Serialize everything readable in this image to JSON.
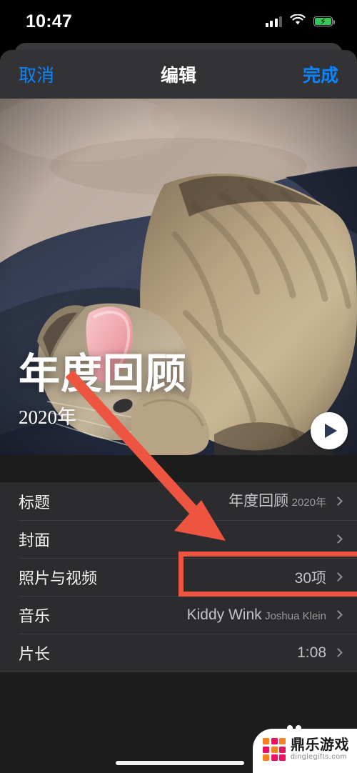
{
  "status_bar": {
    "time": "10:47",
    "signal_icon": "cellular-signal-icon",
    "wifi_icon": "wifi-icon",
    "battery_icon": "battery-charging-icon",
    "battery_bolt": "⚡"
  },
  "nav_bar": {
    "cancel_label": "取消",
    "title": "编辑",
    "done_label": "完成",
    "accent_color": "#0A84FF"
  },
  "hero": {
    "title": "年度回顾",
    "subtitle": "2020年",
    "play_icon": "play-icon",
    "image_description": "tabby cat with pink collar resting on dark navy clothing"
  },
  "table": {
    "rows": [
      {
        "label": "标题",
        "value": "年度回顾",
        "sub": "2020年",
        "name": "row-title"
      },
      {
        "label": "封面",
        "value": "",
        "sub": "",
        "name": "row-cover"
      },
      {
        "label": "照片与视频",
        "value": "30项",
        "sub": "",
        "name": "row-photos-videos"
      },
      {
        "label": "音乐",
        "value": "Kiddy Wink",
        "sub": "Joshua Klein",
        "name": "row-music"
      },
      {
        "label": "片长",
        "value": "1:08",
        "sub": "",
        "name": "row-duration"
      }
    ]
  },
  "annotations": {
    "arrow_color": "#EE5540",
    "highlight_color": "#EE5540",
    "highlight_target": "30项"
  },
  "watermark": {
    "name": "鼎乐游戏",
    "url": "dinglegifts.com",
    "logo_colors": [
      "#F5821F",
      "#ED1164",
      "#F5821F",
      "#ED1164",
      "#F5821F",
      "#ED1164",
      "#F5821F",
      "#ED1164",
      "#ED1164"
    ]
  },
  "home_indicator": {
    "label": "home-indicator"
  }
}
